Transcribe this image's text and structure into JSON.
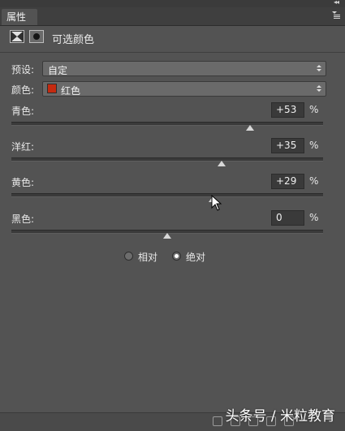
{
  "panel": {
    "tab_label": "属性",
    "adjustment_title": "可选颜色",
    "collapse_glyph": "◂◂"
  },
  "preset": {
    "label": "预设:",
    "value": "自定"
  },
  "colors": {
    "label": "颜色:",
    "value": "红色",
    "swatch_color": "#c42a10"
  },
  "sliders": [
    {
      "label": "青色:",
      "value": "+53",
      "unit": "%",
      "fraction": 0.765
    },
    {
      "label": "洋红:",
      "value": "+35",
      "unit": "%",
      "fraction": 0.675
    },
    {
      "label": "黄色:",
      "value": "+29",
      "unit": "%",
      "fraction": 0.645
    },
    {
      "label": "黑色:",
      "value": "0",
      "unit": "%",
      "fraction": 0.5
    }
  ],
  "method": {
    "relative_label": "相对",
    "absolute_label": "绝对",
    "selected": "absolute"
  },
  "watermark": "头条号 / 米粒教育"
}
